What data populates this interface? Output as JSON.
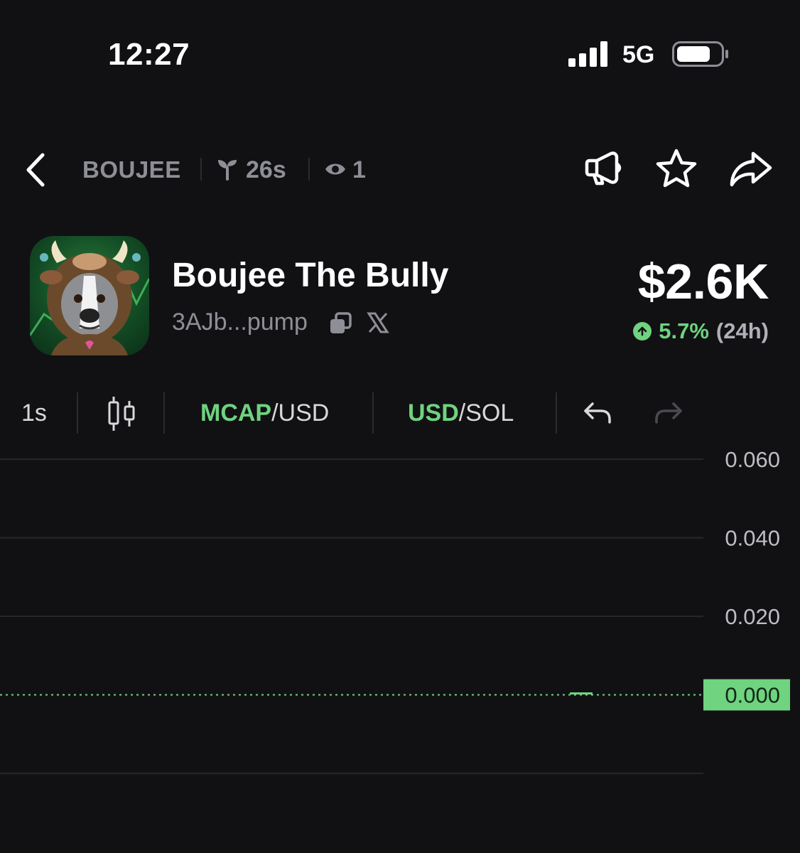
{
  "status_bar": {
    "time": "12:27",
    "network": "5G"
  },
  "nav": {
    "ticker": "BOUJEE",
    "age": "26s",
    "views": "1"
  },
  "token": {
    "name": "Boujee The Bully",
    "address": "3AJb...pump",
    "market_cap": "$2.6K",
    "change_pct": "5.7%",
    "change_period": "(24h)"
  },
  "toolbar": {
    "interval": "1s",
    "toggle1": {
      "active": "MCAP",
      "inactive": "/USD"
    },
    "toggle2": {
      "active": "USD",
      "inactive": "/SOL"
    }
  },
  "colors": {
    "background": "#111114",
    "accent_green": "#6fd37f",
    "muted_text": "#8e8f96"
  },
  "icons": [
    "back-icon",
    "sprout-icon",
    "eye-icon",
    "megaphone-icon",
    "star-icon",
    "share-icon",
    "copy-icon",
    "x-logo-icon",
    "up-arrow-icon",
    "candlestick-icon",
    "undo-icon",
    "redo-icon"
  ],
  "chart_data": {
    "type": "line",
    "y_ticks": [
      "0.060",
      "0.040",
      "0.020",
      "0.000"
    ],
    "ylim": [
      0.0,
      0.06
    ],
    "current_value_label": "0.000",
    "series": [
      {
        "values": [
          0.0
        ]
      }
    ],
    "grid": true
  }
}
